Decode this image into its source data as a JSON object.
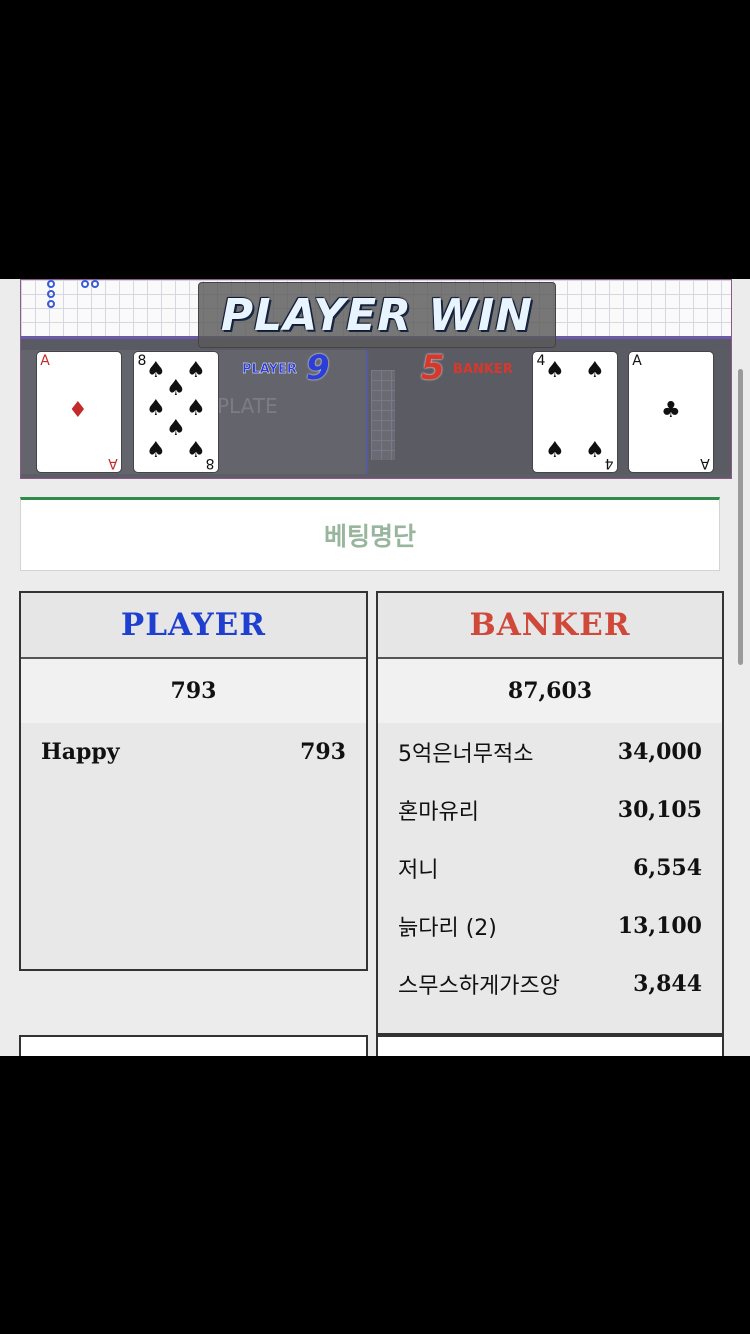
{
  "game": {
    "result_banner": "PLAYER WIN",
    "player_label": "PLAYER",
    "player_score": "9",
    "banker_label": "BANKER",
    "banker_score": "5",
    "player_cards": [
      {
        "rank": "A",
        "suit": "♦",
        "color": "#c42a2a"
      },
      {
        "rank": "8",
        "suit": "♠",
        "color": "#111111"
      }
    ],
    "banker_cards": [
      {
        "rank": "4",
        "suit": "♠",
        "color": "#111111"
      },
      {
        "rank": "A",
        "suit": "♣",
        "color": "#111111"
      }
    ],
    "faint_table_text": "PLATE"
  },
  "betting": {
    "title": "베팅명단",
    "player": {
      "label": "PLAYER",
      "color": "#1e3fd0",
      "total": "793",
      "entries": [
        {
          "name": "Happy",
          "amount": "793"
        }
      ]
    },
    "banker": {
      "label": "BANKER",
      "color": "#d0483a",
      "total": "87,603",
      "entries": [
        {
          "name": "5억은너무적소",
          "amount": "34,000"
        },
        {
          "name": "혼마유리",
          "amount": "30,105"
        },
        {
          "name": "저니",
          "amount": "6,554"
        },
        {
          "name": "늙다리 (2)",
          "amount": "13,100"
        },
        {
          "name": "스무스하게가즈앙",
          "amount": "3,844"
        }
      ]
    }
  }
}
